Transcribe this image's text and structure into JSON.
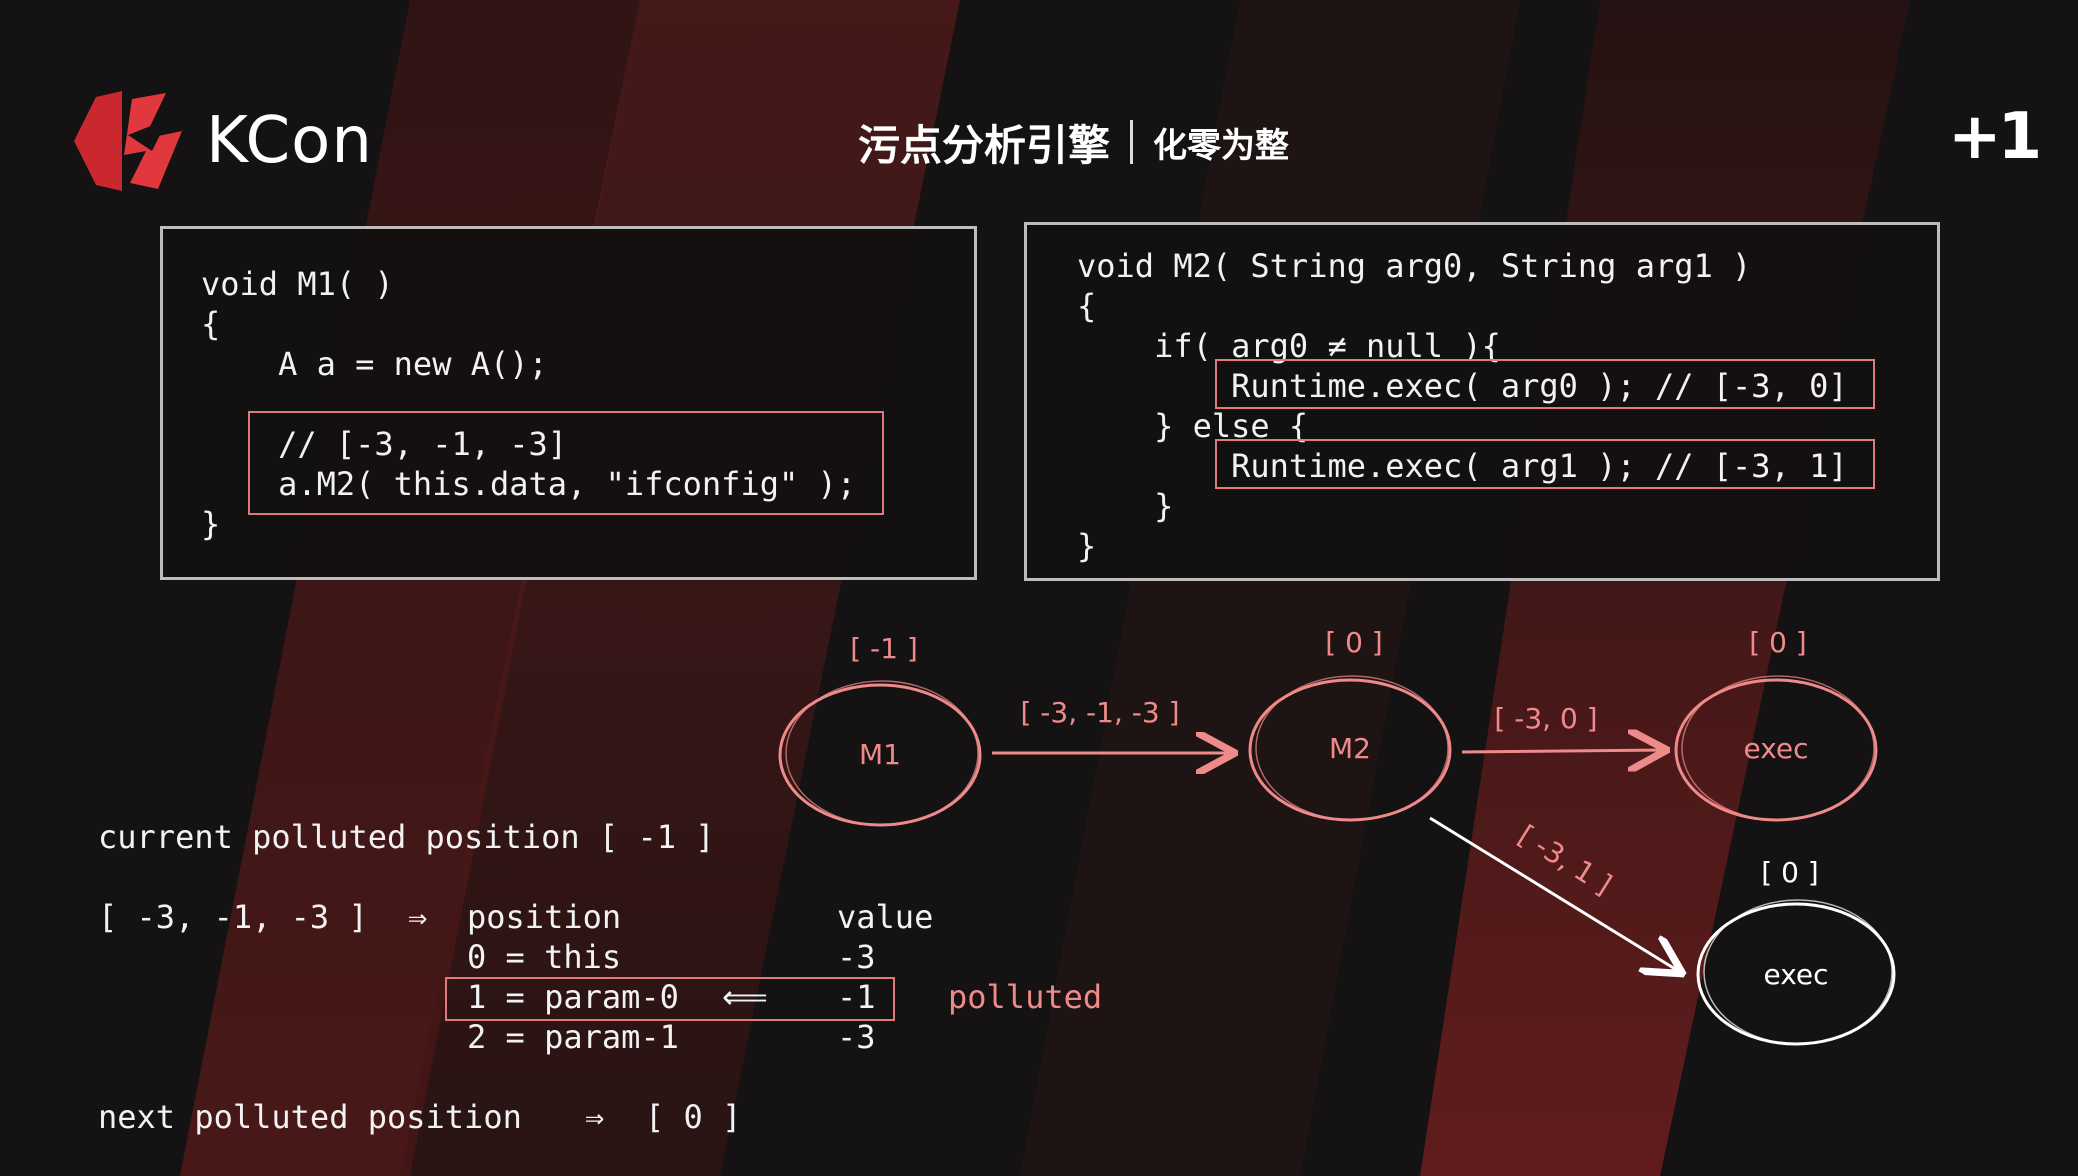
{
  "header": {
    "logo_text": "KCon",
    "title_main": "污点分析引擎",
    "title_sub": "化零为整",
    "badge": "+1"
  },
  "code_m1": {
    "lines": [
      "void M1( )",
      "{",
      "    A a = new A();",
      "    // [-3, -1, -3]",
      "    a.M2( this.data, \"ifconfig\" );",
      "}"
    ]
  },
  "code_m2": {
    "lines": [
      "void M2( String arg0, String arg1 )",
      "{",
      "    if( arg0 ≠ null ){",
      "        Runtime.exec( arg0 ); // [-3, 0]",
      "    } else {",
      "        Runtime.exec( arg1 ); // [-3, 1]",
      "    }",
      "}"
    ]
  },
  "graph": {
    "nodes": [
      {
        "id": "m1",
        "label": "M1",
        "position_label": "[ -1 ]"
      },
      {
        "id": "m2",
        "label": "M2",
        "position_label": "[ 0 ]"
      },
      {
        "id": "exec1",
        "label": "exec",
        "position_label": "[ 0 ]"
      },
      {
        "id": "exec2",
        "label": "exec",
        "position_label": "[ 0 ]"
      }
    ],
    "edges": [
      {
        "from": "m1",
        "to": "m2",
        "label": "[ -3, -1, -3 ]"
      },
      {
        "from": "m2",
        "to": "exec1",
        "label": "[ -3, 0 ]"
      },
      {
        "from": "m2",
        "to": "exec2",
        "label": "[ -3, 1 ]"
      }
    ]
  },
  "analysis": {
    "current": "current polluted position [ -1 ]",
    "vector": "[ -3, -1, -3 ]",
    "arrow": "⇒",
    "col_position": "position",
    "col_value": "value",
    "rows": [
      {
        "position": "0 = this",
        "arrow": "",
        "value": "-3",
        "note": ""
      },
      {
        "position": "1 = param-0",
        "arrow": "⟸",
        "value": "-1",
        "note": "polluted"
      },
      {
        "position": "2 = param-1",
        "arrow": "",
        "value": "-3",
        "note": ""
      }
    ],
    "next_label": "next polluted position",
    "next_arrow": "⇒",
    "next_value": "[ 0 ]"
  },
  "colors": {
    "background": "#141212",
    "stripe": "#7a1e1e",
    "accent": "#ef8a8a",
    "box_border": "#bdbdbd"
  }
}
